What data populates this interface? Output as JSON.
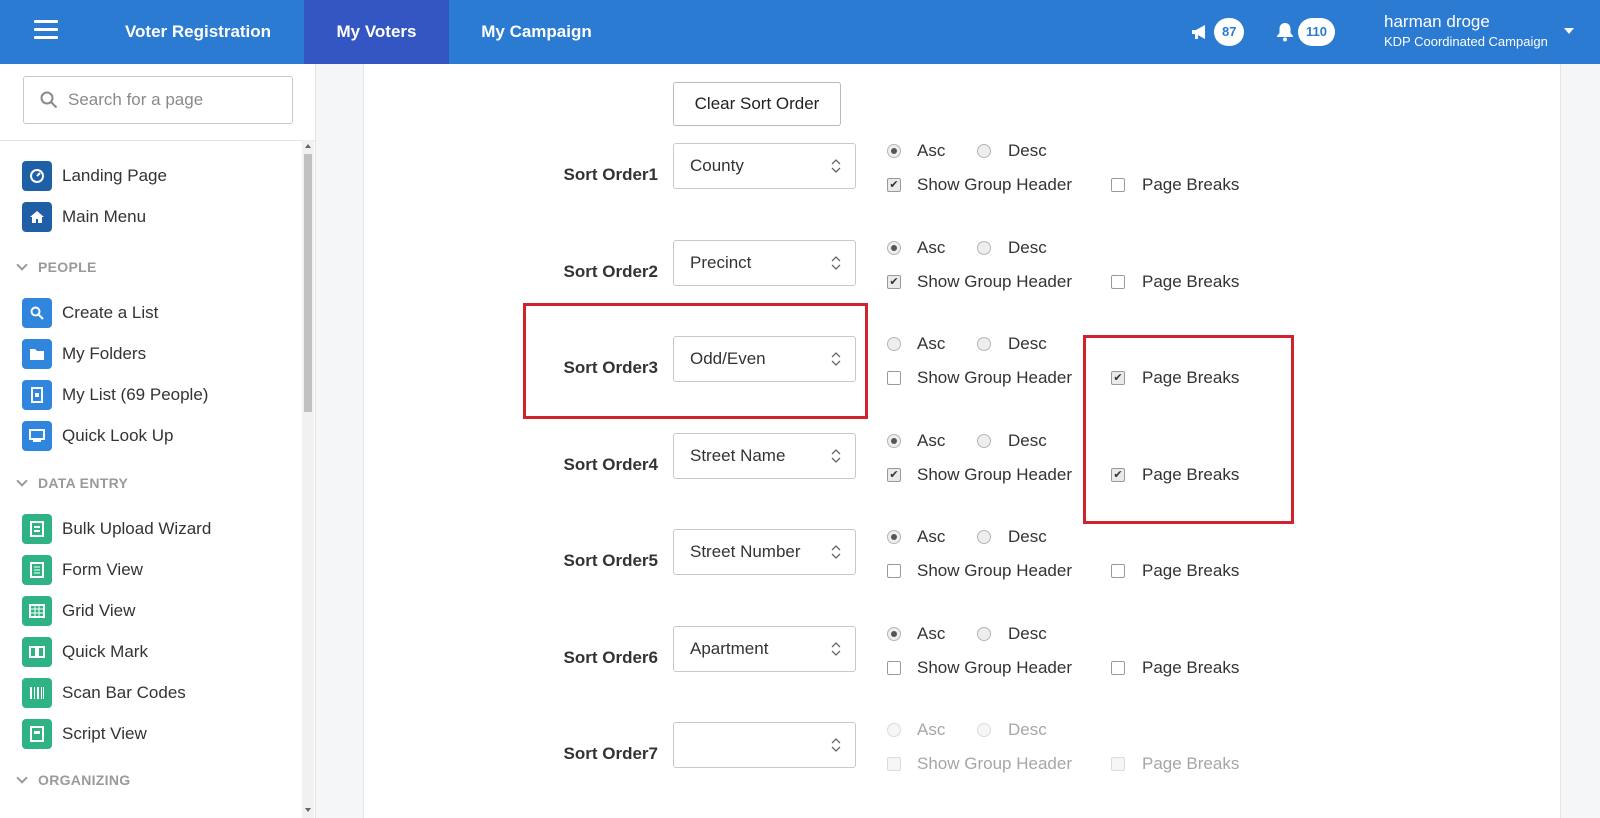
{
  "topbar": {
    "tabs": [
      {
        "label": "Voter Registration"
      },
      {
        "label": "My Voters"
      },
      {
        "label": "My Campaign"
      }
    ],
    "announcements_count": "87",
    "notifications_count": "110",
    "user_name": "harman droge",
    "campaign_name": "KDP Coordinated Campaign"
  },
  "sidebar": {
    "search_placeholder": "Search for a page",
    "top_items": [
      {
        "label": "Landing Page",
        "icon": "dashboard-icon"
      },
      {
        "label": "Main Menu",
        "icon": "home-icon"
      }
    ],
    "sections": [
      {
        "title": "PEOPLE",
        "items": [
          {
            "label": "Create a List",
            "icon": "search-icon"
          },
          {
            "label": "My Folders",
            "icon": "folder-icon"
          },
          {
            "label": "My List (69 People)",
            "icon": "list-icon"
          },
          {
            "label": "Quick Look Up",
            "icon": "id-card-icon"
          }
        ]
      },
      {
        "title": "DATA ENTRY",
        "items": [
          {
            "label": "Bulk Upload Wizard",
            "icon": "upload-icon"
          },
          {
            "label": "Form View",
            "icon": "form-icon"
          },
          {
            "label": "Grid View",
            "icon": "grid-icon"
          },
          {
            "label": "Quick Mark",
            "icon": "book-icon"
          },
          {
            "label": "Scan Bar Codes",
            "icon": "barcode-icon"
          },
          {
            "label": "Script View",
            "icon": "script-icon"
          }
        ]
      },
      {
        "title": "ORGANIZING",
        "items": []
      }
    ]
  },
  "main": {
    "clear_button": "Clear Sort Order",
    "asc_label": "Asc",
    "desc_label": "Desc",
    "group_header_label": "Show Group Header",
    "page_breaks_label": "Page Breaks",
    "rows": [
      {
        "label": "Sort Order1",
        "value": "County",
        "direction": "asc",
        "group_header": true,
        "page_breaks": false,
        "enabled": true
      },
      {
        "label": "Sort Order2",
        "value": "Precinct",
        "direction": "asc",
        "group_header": true,
        "page_breaks": false,
        "enabled": true
      },
      {
        "label": "Sort Order3",
        "value": "Odd/Even",
        "direction": "none",
        "group_header": false,
        "page_breaks": true,
        "enabled": true
      },
      {
        "label": "Sort Order4",
        "value": "Street Name",
        "direction": "asc",
        "group_header": true,
        "page_breaks": true,
        "enabled": true
      },
      {
        "label": "Sort Order5",
        "value": "Street Number",
        "direction": "asc",
        "group_header": false,
        "page_breaks": false,
        "enabled": true
      },
      {
        "label": "Sort Order6",
        "value": "Apartment",
        "direction": "asc",
        "group_header": false,
        "page_breaks": false,
        "enabled": true
      },
      {
        "label": "Sort Order7",
        "value": "",
        "direction": "none",
        "group_header": false,
        "page_breaks": false,
        "enabled": false
      }
    ]
  },
  "colors": {
    "topbar": "#2a7bd1",
    "active_tab": "#3456c3",
    "highlight": "#d1232e"
  }
}
